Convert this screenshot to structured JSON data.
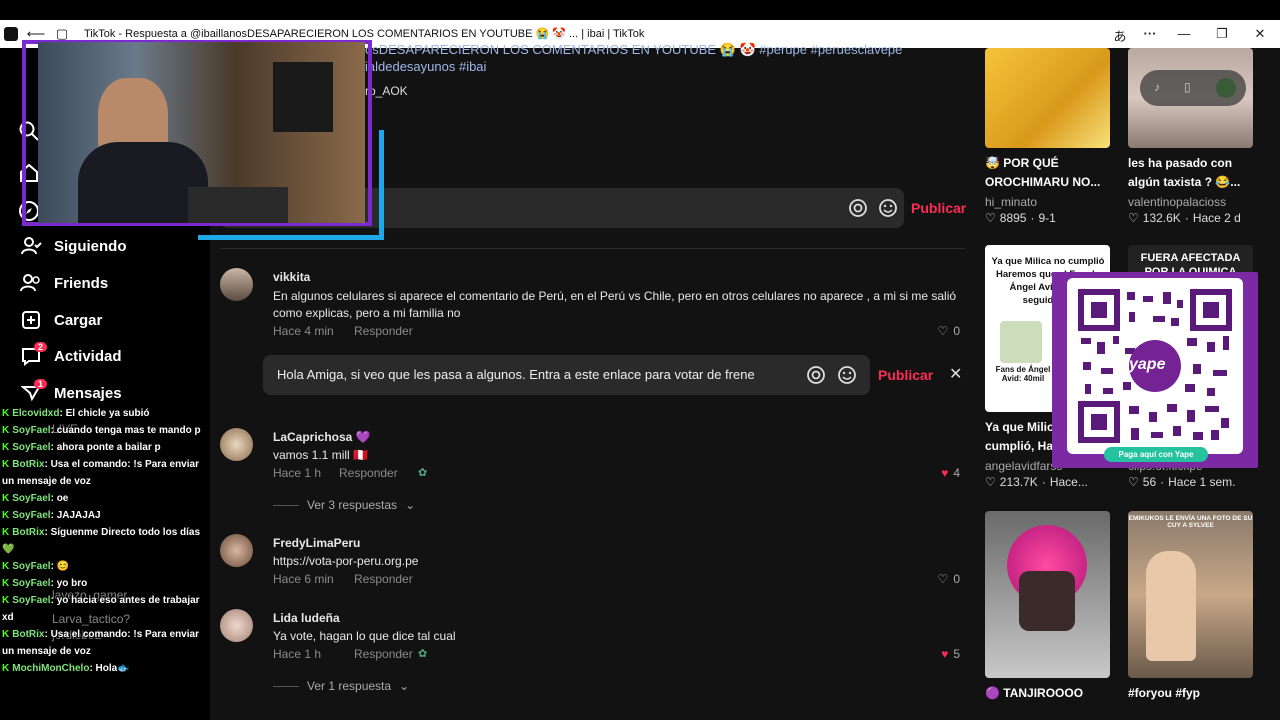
{
  "window": {
    "title": "TikTok - Respuesta a @ibaillanosDESAPARECIERON LOS COMENTARIOS EN YOUTUBE 😭 🤡 ... | ibai | TikTok"
  },
  "video": {
    "caption_line1": "osDESAPARECIERON LOS COMENTARIOS EN YOUTUBE 😭 🤡 #perupe #peruesclavepe",
    "caption_line2": "ialdedesayunos #ibai",
    "author_partial": "ro_AOK"
  },
  "comment_input": {
    "publish": "Publicar"
  },
  "nav": {
    "following": "Siguiendo",
    "friends": "Friends",
    "upload": "Cargar",
    "activity": "Actividad",
    "activity_badge": "2",
    "messages": "Mensajes",
    "messages_badge": "1"
  },
  "comments": [
    {
      "user": "vikkita",
      "text": "En algunos celulares si aparece el comentario de Perú, en el Perú vs Chile, pero en otros celulares no aparece , a mi si me salió como explicas, pero a mi familia no",
      "time": "Hace 4 min",
      "reply": "Responder",
      "likes": "0"
    },
    {
      "user": "LaCaprichosa 💜",
      "text": "vamos 1.1 mill 🇵🇪",
      "time": "Hace 1 h",
      "reply": "Responder",
      "likes": "4",
      "view_replies": "Ver 3 respuestas"
    },
    {
      "user": "FredyLimaPeru",
      "text": "https://vota-por-peru.org.pe",
      "time": "Hace 6 min",
      "reply": "Responder",
      "likes": "0"
    },
    {
      "user": "Lida ludeña",
      "text": "Ya vote, hagan lo que dice tal cual",
      "time": "Hace 1 h",
      "reply": "Responder",
      "likes": "5",
      "view_replies": "Ver 1 respuesta"
    }
  ],
  "reply_input": {
    "value": "Hola Amiga, si veo que les pasa a algunos. Entra a este enlace para votar de frene",
    "publish": "Publicar"
  },
  "videos": [
    {
      "desc": "🤯 POR QUÉ OROCHIMARU NO...",
      "author": "hi_minato",
      "likes": "8895",
      "date": "9-1"
    },
    {
      "desc": "les ha pasado con algún taxista ? 😂...",
      "author": "valentinopalacioss",
      "likes": "132.6K",
      "date": "Hace 2 d"
    },
    {
      "desc": "Ya que Milica no cumplió, Ha...",
      "author": "angelavidfarss",
      "likes": "213.7K",
      "date": "Hace...",
      "thumb_text": "Ya que Milica no cumplió Haremos que el Fan de Ángel Avid tenga seguidores",
      "thumb_caption": "Fans de Ángel Avid: 40mil"
    },
    {
      "desc": "",
      "author": "clips.of.kickpe",
      "likes": "56",
      "date": "Hace 1 sem.",
      "thumb_text": "FUERA AFECTADA POR LA QUIMICA"
    },
    {
      "desc": "🟣 TANJIROOOO",
      "author": "",
      "likes": "",
      "date": ""
    },
    {
      "desc": "#foryou #fyp",
      "author": "",
      "likes": "",
      "date": "",
      "thumb_text": "EMIKUKOS LE ENVÍA UNA FOTO DE SU CUY A SYLVEE"
    }
  ],
  "qr": {
    "brand": "yape",
    "cta": "Paga aquí con Yape"
  },
  "chat": [
    {
      "user": "Elcovidxd",
      "msg": ": El chicle ya subió"
    },
    {
      "user": "SoyFael",
      "msg": ": cuando tenga mas te mando p"
    },
    {
      "user": "SoyFael",
      "msg": ": ahora ponte a bailar p"
    },
    {
      "user": "BotRix",
      "msg": ": Usa el comando: !s Para enviar un mensaje de voz"
    },
    {
      "user": "SoyFael",
      "msg": ": oe"
    },
    {
      "user": "SoyFael",
      "msg": ": JAJAJAJ"
    },
    {
      "user": "BotRix",
      "msg": ": Síguenme Directo todo los días 💚"
    },
    {
      "user": "SoyFael",
      "msg": ": 😊"
    },
    {
      "user": "SoyFael",
      "msg": ": yo bro"
    },
    {
      "user": "SoyFael",
      "msg": ": yo hacia eso antes de trabajar xd"
    },
    {
      "user": "BotRix",
      "msg": ": Usa el comando: !s Para enviar un mensaje de voz"
    },
    {
      "user": "MochiMonChelo",
      "msg": ": Hola🐟"
    }
  ],
  "ghost": {
    "live": "LIVE",
    "g1": "lavezo_gamer",
    "g2": "Larva_tactico?",
    "g3": "jordlobo2"
  }
}
